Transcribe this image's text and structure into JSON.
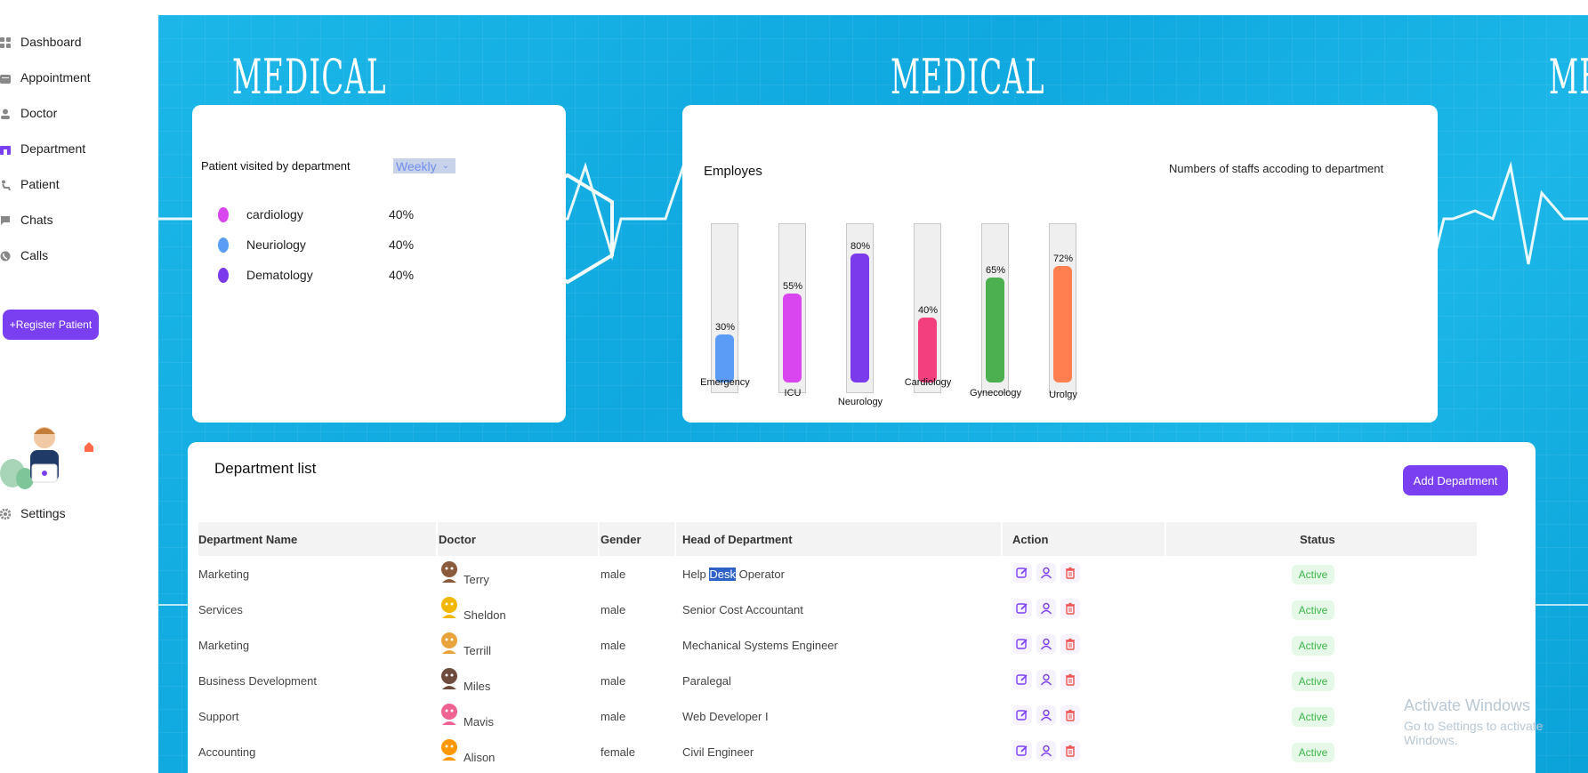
{
  "sidebar": {
    "items": [
      {
        "label": "Dashboard",
        "icon": "grid-icon"
      },
      {
        "label": "Appointment",
        "icon": "calendar-icon"
      },
      {
        "label": "Doctor",
        "icon": "doctor-icon"
      },
      {
        "label": "Department",
        "icon": "building-icon"
      },
      {
        "label": "Patient",
        "icon": "patient-icon"
      },
      {
        "label": "Chats",
        "icon": "chat-icon"
      },
      {
        "label": "Calls",
        "icon": "phone-icon"
      }
    ],
    "register_label": "+Register Patient",
    "settings_label": "Settings"
  },
  "banner": {
    "word": "MEDICAL"
  },
  "visits": {
    "title": "Patient visited by department",
    "period": "Weekly",
    "legend": [
      {
        "name": "cardiology",
        "value": "40%",
        "color": "#d946ef"
      },
      {
        "name": "Neuriology",
        "value": "40%",
        "color": "#5b9cf6"
      },
      {
        "name": "Dematology",
        "value": "40%",
        "color": "#7c3aed"
      }
    ]
  },
  "employees": {
    "title": "Employes",
    "subtitle": "Numbers of staffs accoding to department"
  },
  "chart_data": {
    "type": "bar",
    "title": "Employes",
    "subtitle": "Numbers of staffs accoding to department",
    "categories": [
      "Emergency",
      "ICU",
      "Neurology",
      "Cardiology",
      "Gynecology",
      "Urolgy"
    ],
    "values": [
      30,
      55,
      80,
      40,
      65,
      72
    ],
    "value_labels": [
      "30%",
      "55%",
      "80%",
      "40%",
      "65%",
      "72%"
    ],
    "colors": [
      "#5b9cf6",
      "#d946ef",
      "#7c3aed",
      "#f43f7f",
      "#4caf50",
      "#ff7f50"
    ],
    "ylim": [
      0,
      100
    ]
  },
  "departments": {
    "title": "Department list",
    "add_label": "Add Department",
    "headers": [
      "Department Name",
      "Doctor",
      "Gender",
      "Head of Department",
      "Action",
      "Status"
    ],
    "rows": [
      {
        "dept": "Marketing",
        "doctor": "Terry",
        "gender": "male",
        "head": "Help Desk Operator",
        "status": "Active",
        "avatar": "#8a5a3c"
      },
      {
        "dept": "Services",
        "doctor": "Sheldon",
        "gender": "male",
        "head": "Senior Cost Accountant",
        "status": "Active",
        "avatar": "#f2b705"
      },
      {
        "dept": "Marketing",
        "doctor": "Terrill",
        "gender": "male",
        "head": "Mechanical Systems Engineer",
        "status": "Active",
        "avatar": "#e8a33d"
      },
      {
        "dept": "Business Development",
        "doctor": "Miles",
        "gender": "male",
        "head": "Paralegal",
        "status": "Active",
        "avatar": "#6d4c3d"
      },
      {
        "dept": "Support",
        "doctor": "Mavis",
        "gender": "male",
        "head": "Web Developer I",
        "status": "Active",
        "avatar": "#f06292"
      },
      {
        "dept": "Accounting",
        "doctor": "Alison",
        "gender": "female",
        "head": "Civil Engineer",
        "status": "Active",
        "avatar": "#ff9800"
      }
    ]
  },
  "watermark": {
    "line1": "Activate Windows",
    "line2": "Go to Settings to activate Windows."
  }
}
